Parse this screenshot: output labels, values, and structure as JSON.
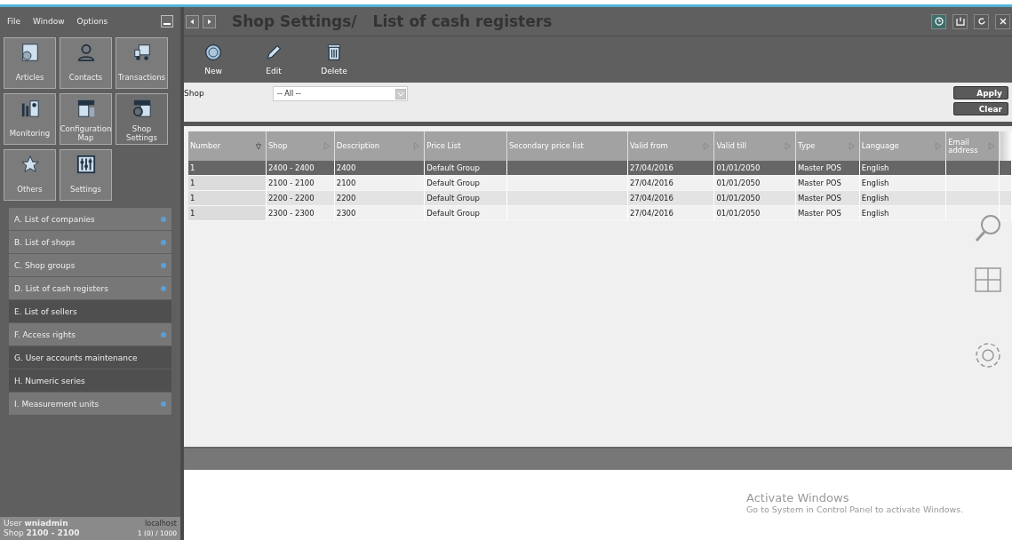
{
  "menu": [
    "File",
    "Window",
    "Options"
  ],
  "tiles": [
    {
      "label": "Articles",
      "selected": false
    },
    {
      "label": "Contacts",
      "selected": false
    },
    {
      "label": "Transactions",
      "selected": false
    },
    {
      "label": "Monitoring",
      "selected": false
    },
    {
      "label": "Configuration Map",
      "selected": false
    },
    {
      "label": "Shop Settings",
      "selected": true
    },
    {
      "label": "Others",
      "selected": false
    },
    {
      "label": "Settings",
      "selected": false
    }
  ],
  "sections": [
    {
      "label": "A. List of companies",
      "dot": true
    },
    {
      "label": "B. List of shops",
      "dot": true
    },
    {
      "label": "C. Shop groups",
      "dot": true
    },
    {
      "label": "D. List of cash registers",
      "dot": true
    },
    {
      "label": "E. List of sellers",
      "dot": false
    },
    {
      "label": "F. Access rights",
      "dot": true
    },
    {
      "label": "G. User accounts maintenance",
      "dot": false
    },
    {
      "label": "H. Numeric series",
      "dot": false
    },
    {
      "label": "I. Measurement units",
      "dot": true
    }
  ],
  "status_bar": {
    "user": "User **wniadmin**",
    "shop": "Shop **2100 - 2100**",
    "host": "localhost",
    "count": "1 (0) / 1000"
  },
  "title": {
    "section": "Shop Settings/",
    "page": "List of cash registers"
  },
  "window_buttons": [
    {
      "selected": true
    },
    {
      "selected": false
    },
    {
      "selected": false
    },
    {
      "selected": false
    }
  ],
  "toolbar": [
    "New",
    "Edit",
    "Delete"
  ],
  "filter": {
    "label": "Shop",
    "value": "-- All --",
    "buttons": [
      "Apply",
      "Clear"
    ]
  },
  "table": {
    "columns": [
      {
        "label": "Number",
        "kind": "sorted"
      },
      {
        "label": "Shop",
        "kind": "sortable"
      },
      {
        "label": "Description",
        "kind": "sortable"
      },
      {
        "label": "Price List",
        "kind": "plain"
      },
      {
        "label": "Secondary price list",
        "kind": "plain"
      },
      {
        "label": "Valid from",
        "kind": "sortable"
      },
      {
        "label": "Valid till",
        "kind": "sortable"
      },
      {
        "label": "Type",
        "kind": "sortable"
      },
      {
        "label": "Language",
        "kind": "sortable"
      },
      {
        "label": "Email address",
        "kind": "sortable"
      }
    ],
    "rows": [
      {
        "selected": true,
        "cells": [
          "1",
          "2400 - 2400",
          "2400",
          "Default Group",
          "",
          "27/04/2016",
          "01/01/2050",
          "Master POS",
          "English",
          ""
        ]
      },
      {
        "selected": false,
        "cells": [
          "1",
          "2100 - 2100",
          "2100",
          "Default Group",
          "",
          "27/04/2016",
          "01/01/2050",
          "Master POS",
          "English",
          ""
        ]
      },
      {
        "selected": false,
        "cells": [
          "1",
          "2200 - 2200",
          "2200",
          "Default Group",
          "",
          "27/04/2016",
          "01/01/2050",
          "Master POS",
          "English",
          ""
        ]
      },
      {
        "selected": false,
        "cells": [
          "1",
          "2300 - 2300",
          "2300",
          "Default Group",
          "",
          "27/04/2016",
          "01/01/2050",
          "Master POS",
          "English",
          ""
        ]
      }
    ]
  },
  "activation": {
    "title": "Activate Windows",
    "text": "Go to System in Control Panel to activate Windows."
  }
}
